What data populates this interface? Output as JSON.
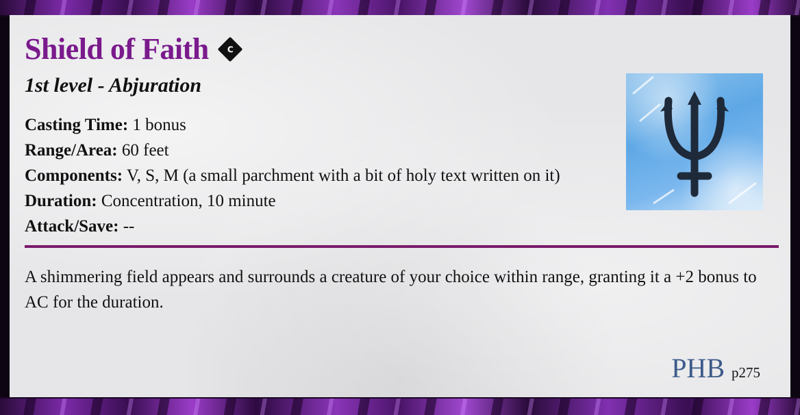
{
  "spell": {
    "name": "Shield of Faith",
    "concentration_badge": "C",
    "level_school": "1st level - Abjuration",
    "stats": [
      {
        "label": "Casting Time:",
        "value": "1 bonus"
      },
      {
        "label": "Range/Area:",
        "value": "60 feet"
      },
      {
        "label": "Components:",
        "value": "V, S, M (a small parchment with a bit of holy text written on it)"
      },
      {
        "label": "Duration:",
        "value": "Concentration, 10 minute"
      },
      {
        "label": "Attack/Save:",
        "value": "--"
      }
    ],
    "description": "A shimmering field appears and surrounds a creature of your choice within range, granting it a +2 bonus to AC for the duration.",
    "source_book": "PHB",
    "source_page": "p275",
    "art_icon": "trident-psi-icon"
  },
  "colors": {
    "title": "#7a1a8c",
    "divider": "#7a1a6a",
    "source_book": "#3d5a8a",
    "border": "#7b2aa8"
  }
}
